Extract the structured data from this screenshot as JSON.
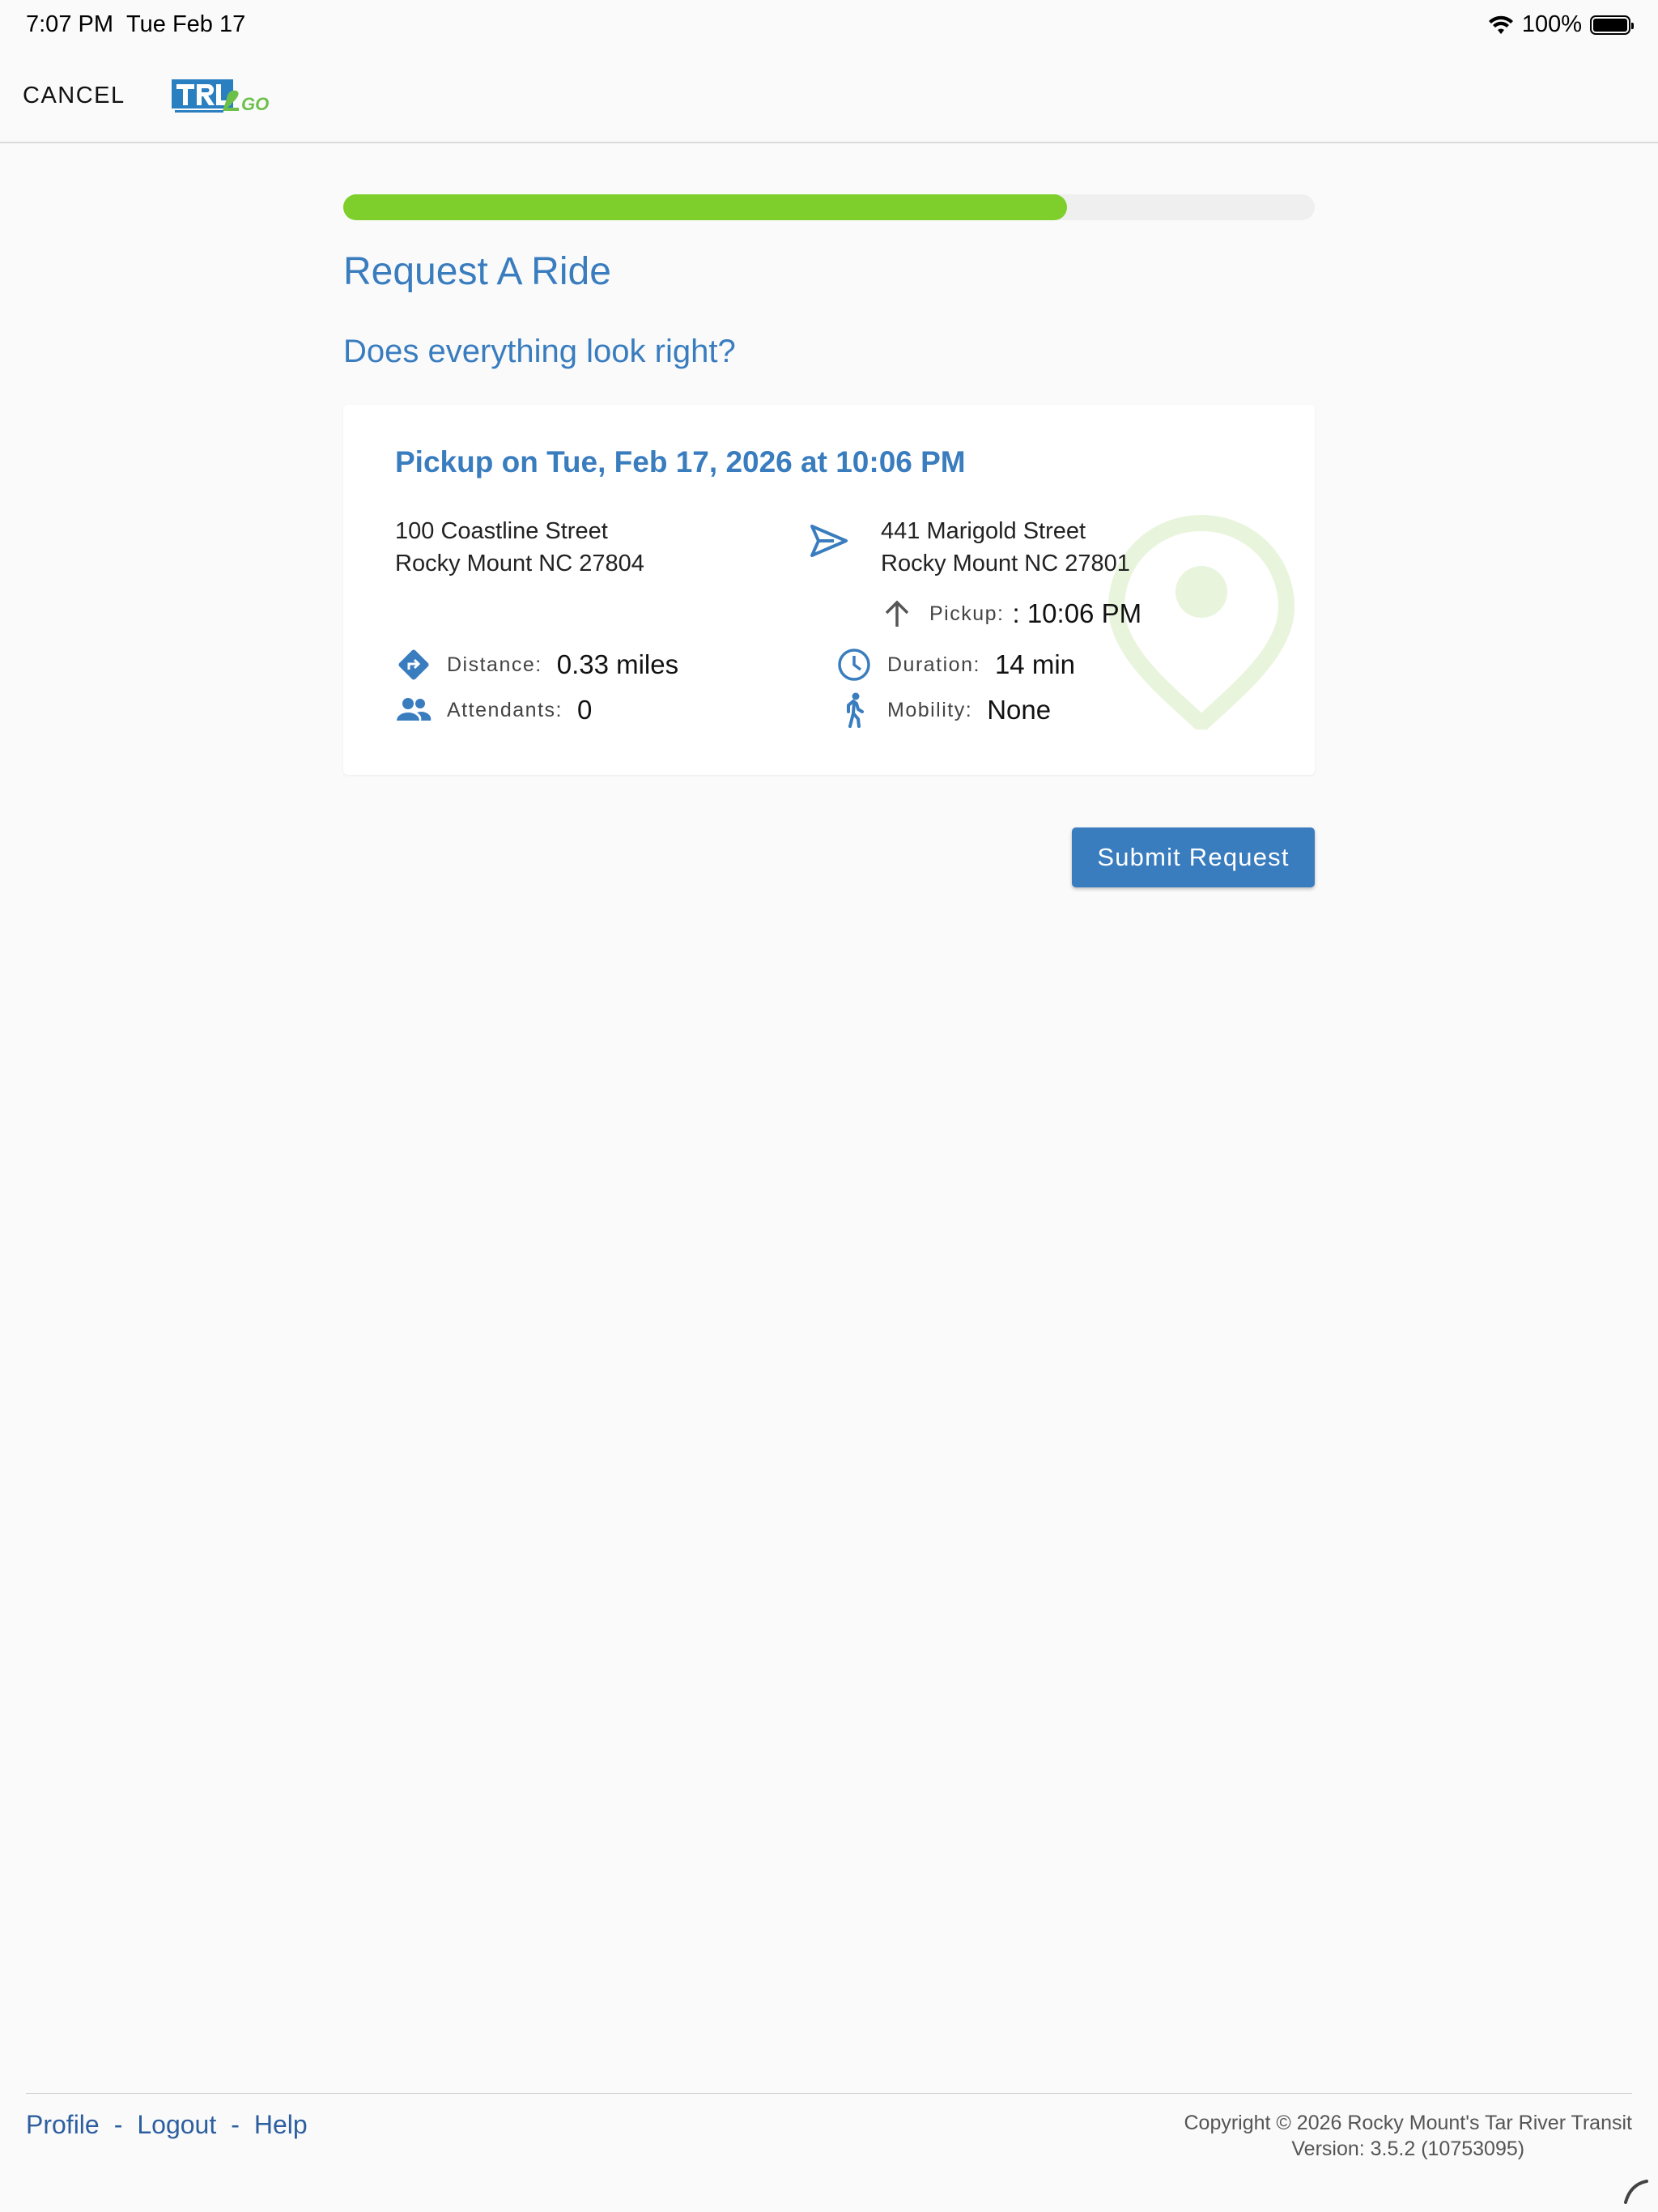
{
  "status_bar": {
    "time": "7:07 PM",
    "date": "Tue Feb 17",
    "battery": "100%"
  },
  "header": {
    "cancel_label": "CANCEL",
    "logo_icon": "tar-river-transit-2go-logo"
  },
  "progress": {
    "fraction": 0.745,
    "color": "#7ecf2b"
  },
  "main": {
    "title": "Request A Ride",
    "subtitle": "Does everything look right?"
  },
  "trip": {
    "heading": "Pickup on Tue, Feb 17, 2026 at 10:06 PM",
    "origin": {
      "line1": "100 Coastline Street",
      "line2": "Rocky Mount NC 27804"
    },
    "destination": {
      "line1": "441 Marigold Street",
      "line2": "Rocky Mount NC 27801"
    },
    "pickup": {
      "label": "Pickup:",
      "value": ": 10:06 PM"
    },
    "distance": {
      "label": "Distance:",
      "value": "0.33 miles",
      "icon": "directions-icon"
    },
    "attendants": {
      "label": "Attendants:",
      "value": "0",
      "icon": "people-icon"
    },
    "duration": {
      "label": "Duration:",
      "value": "14 min",
      "icon": "clock-icon"
    },
    "mobility": {
      "label": "Mobility:",
      "value": "None",
      "icon": "walking-person-icon"
    }
  },
  "actions": {
    "submit_label": "Submit Request"
  },
  "footer": {
    "links": [
      "Profile",
      "Logout",
      "Help"
    ],
    "separator": "-",
    "copyright": "Copyright © 2026 Rocky Mount's Tar River Transit",
    "version": "Version: 3.5.2 (10753095)"
  },
  "colors": {
    "accent": "#3a7dbf",
    "progress": "#7ecf2b",
    "watermark": "#e8f5dc"
  }
}
